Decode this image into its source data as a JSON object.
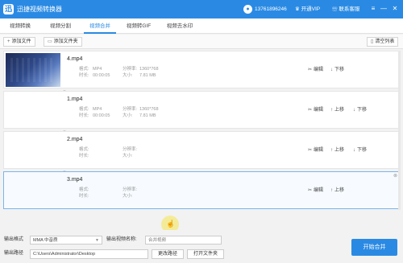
{
  "app": {
    "title": "迅捷视频转换器",
    "logo": "迅"
  },
  "user": {
    "phone": "13761896246",
    "vip_label": "开通VIP",
    "service_label": "联系客服"
  },
  "window_controls": {
    "menu_icon": "≡",
    "minimize": "—",
    "close": "✕"
  },
  "tabs": [
    {
      "label": "视频转换",
      "active": false
    },
    {
      "label": "视频分割",
      "active": false
    },
    {
      "label": "视频合并",
      "active": true
    },
    {
      "label": "视频转GIF",
      "active": false
    },
    {
      "label": "视频去水印",
      "active": false
    }
  ],
  "toolbar": {
    "add_file": "添加文件",
    "add_folder": "添加文件夹",
    "clear_list": "清空列表"
  },
  "labels": {
    "format": "格式:",
    "resolution": "分辨率:",
    "duration": "时长:",
    "size": "大小:",
    "edit": "编辑",
    "up": "上移",
    "down": "下移"
  },
  "items": [
    {
      "name": "4.mp4",
      "format": "MP4",
      "resolution": "1360*768",
      "duration": "00:00:05",
      "size": "7.81 MB",
      "has_thumb": true,
      "actions": [
        "edit",
        "down"
      ]
    },
    {
      "name": "1.mp4",
      "format": "MP4",
      "resolution": "1360*768",
      "duration": "00:00:05",
      "size": "7.81 MB",
      "has_thumb": false,
      "actions": [
        "edit",
        "up",
        "down"
      ]
    },
    {
      "name": "2.mp4",
      "format": "",
      "resolution": "",
      "duration": "",
      "size": "",
      "has_thumb": false,
      "actions": [
        "edit",
        "up",
        "down"
      ]
    },
    {
      "name": "3.mp4",
      "format": "",
      "resolution": "",
      "duration": "",
      "size": "",
      "has_thumb": false,
      "actions": [
        "edit",
        "up"
      ],
      "selected": true
    }
  ],
  "bottom": {
    "format_label": "输出格式",
    "format_value": "MMA  中音质",
    "name_label": "输出视频名称:",
    "name_value": "合并视频",
    "path_label": "输出路径",
    "path_value": "C:\\Users\\Administrator\\Desktop",
    "change_path": "更改路径",
    "open_folder": "打开文件夹",
    "start_merge": "开始合并"
  },
  "colors": {
    "accent": "#2a8ae3",
    "cursor_highlight": "#f5e650"
  }
}
